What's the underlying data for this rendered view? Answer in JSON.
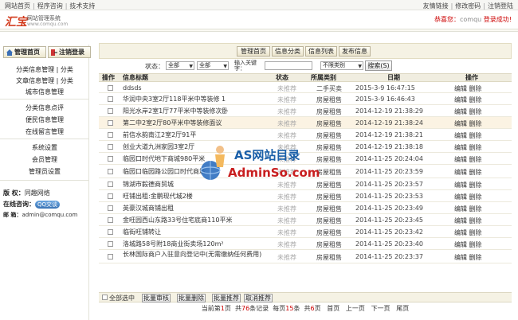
{
  "top_links_left": [
    "网站首页",
    "程序咨询",
    "技术支持"
  ],
  "top_links_right": [
    "友情链接",
    "修改密码",
    "注销登陆"
  ],
  "header": {
    "logo_text": "汇宝",
    "logo_subtitle": "网站管理系统",
    "logo_url": "www.comqu.com",
    "welcome_prefix": "恭喜您：",
    "welcome_user": "comqu",
    "welcome_suffix": " 登录成功!"
  },
  "sidebar": {
    "home_button": "管理首页",
    "logout_button": "注销登录",
    "groups": [
      [
        "分类信息管理",
        "|",
        "分类"
      ],
      [
        "文章信息管理",
        "|",
        "分类"
      ],
      [
        "城市信息管理"
      ],
      [
        "分类信息点评"
      ],
      [
        "便民信息管理"
      ],
      [
        "在线留言管理"
      ],
      [
        "系统设置"
      ],
      [
        "会员管理"
      ],
      [
        "管理员设置"
      ]
    ],
    "copyright_label": "版 权：",
    "copyright_value": "同趣网络",
    "online_label": "在线咨询：",
    "qq_label": "QQ交谈",
    "email_label": "邮 箱：",
    "email_value": "admin@comqu.com"
  },
  "actions": [
    "管理首页",
    "信息分类",
    "信息列表",
    "发布信息"
  ],
  "filter": {
    "status_label": "状态：",
    "status_select": "全部",
    "status_select2": "全部",
    "keyword_label": "输入关键字：",
    "category_select": "不限类别",
    "search_button": "搜索(S)"
  },
  "table": {
    "headers": [
      "操作",
      "信息标题",
      "状态",
      "所属类别",
      "日期",
      "操作"
    ],
    "rows": [
      {
        "title": "ddsds",
        "status": "未推荐",
        "cat": "二手买卖",
        "date": "2015-3-9 16:47:15",
        "ops": "编辑 删除"
      },
      {
        "title": "华润中央3室2厅118平米中等装修 1",
        "status": "未推荐",
        "cat": "房屋租售",
        "date": "2015-3-9 16:46:43",
        "ops": "编辑 删除"
      },
      {
        "title": "阳光水岸2室1厅77平米中等装修次卧",
        "status": "未推荐",
        "cat": "房屋租售",
        "date": "2014-12-19 21:38:29",
        "ops": "编辑 删除"
      },
      {
        "title": "第二中2室2厅80平米中等装修面议",
        "status": "未推荐",
        "cat": "房屋租售",
        "date": "2014-12-19 21:38:24",
        "ops": "编辑 删除"
      },
      {
        "title": "前信水韵南江2室2厅91平",
        "status": "未推荐",
        "cat": "房屋租售",
        "date": "2014-12-19 21:38:21",
        "ops": "编辑 删除"
      },
      {
        "title": "创业大道九洲家园3室2厅",
        "status": "未推荐",
        "cat": "房屋租售",
        "date": "2014-12-19 21:38:18",
        "ops": "编辑 删除"
      },
      {
        "title": "临园口时代地下商城980平米",
        "status": "未推荐",
        "cat": "房屋租售",
        "date": "2014-11-25 20:24:04",
        "ops": "编辑 删除"
      },
      {
        "title": "临园口临园路公园口时代商城",
        "status": "未推荐",
        "cat": "房屋租售",
        "date": "2014-11-25 20:23:59",
        "ops": "编辑 删除"
      },
      {
        "title": "锦湖市毅德商贸城",
        "status": "未推荐",
        "cat": "房屋租售",
        "date": "2014-11-25 20:23:57",
        "ops": "编辑 删除"
      },
      {
        "title": "旺铺出租:金鹏现代城2楼",
        "status": "未推荐",
        "cat": "房屋租售",
        "date": "2014-11-25 20:23:53",
        "ops": "编辑 删除"
      },
      {
        "title": "英豪汉城商铺出租",
        "status": "未推荐",
        "cat": "房屋租售",
        "date": "2014-11-25 20:23:49",
        "ops": "编辑 删除"
      },
      {
        "title": "金旺园西山东路33号住宅底商110平米",
        "status": "未推荐",
        "cat": "房屋租售",
        "date": "2014-11-25 20:23:45",
        "ops": "编辑 删除"
      },
      {
        "title": "临街旺铺转让",
        "status": "未推荐",
        "cat": "房屋租售",
        "date": "2014-11-25 20:23:42",
        "ops": "编辑 删除"
      },
      {
        "title": "洛城路58号附18商业街卖场120m²",
        "status": "未推荐",
        "cat": "房屋租售",
        "date": "2014-11-25 20:23:40",
        "ops": "编辑 删除"
      },
      {
        "title": "长林国际商户入驻意向登记中(无需缴纳任何费用)",
        "status": "未推荐",
        "cat": "房屋租售",
        "date": "2014-11-25 20:23:37",
        "ops": "编辑 删除"
      }
    ]
  },
  "bulk": {
    "select_all": "全部选中",
    "buttons": [
      "批量审核",
      "批量删除",
      "批量推荐",
      "取消推荐"
    ]
  },
  "pager": {
    "current_prefix": "当前第",
    "current": "1",
    "current_suffix": "页",
    "total_prefix": "共",
    "total": "76",
    "total_suffix": "条记录",
    "per_prefix": "每页",
    "per": "15",
    "per_suffix": "条",
    "pages_prefix": "共",
    "pages": "6",
    "pages_suffix": "页",
    "first": "首页",
    "prev": "上一页",
    "next": "下一页",
    "last": "尾页"
  },
  "watermark": {
    "line1": "AS网站目录",
    "line2": "AdminSo.com"
  }
}
